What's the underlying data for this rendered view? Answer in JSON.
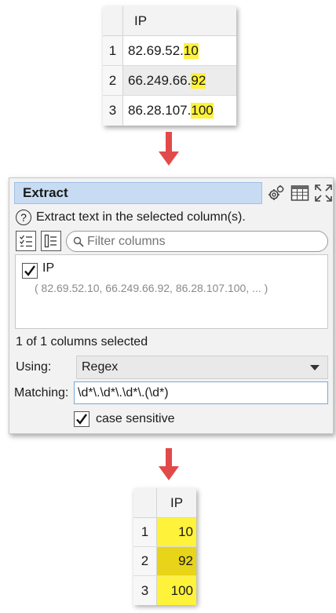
{
  "top_table": {
    "column": "IP",
    "rows": [
      {
        "num": "1",
        "prefix": "82.69.52.",
        "match": "10"
      },
      {
        "num": "2",
        "prefix": "66.249.66.",
        "match": "92"
      },
      {
        "num": "3",
        "prefix": "86.28.107.",
        "match": "100"
      }
    ]
  },
  "panel": {
    "title": "Extract",
    "description": "Extract text in the selected column(s).",
    "help_symbol": "?",
    "filter_placeholder": "Filter columns",
    "columns": [
      {
        "name": "IP",
        "checked": true,
        "sample": "( 82.69.52.10, 66.249.66.92, 86.28.107.100, ... )"
      }
    ],
    "selected_count": "1 of 1 columns selected",
    "using_label": "Using:",
    "using_value": "Regex",
    "matching_label": "Matching:",
    "matching_value": "\\d*\\.\\d*\\.\\d*\\.(\\d*)",
    "case_sensitive_label": "case sensitive",
    "case_sensitive_checked": true
  },
  "bottom_table": {
    "column": "IP",
    "rows": [
      {
        "num": "1",
        "value": "10"
      },
      {
        "num": "2",
        "value": "92"
      },
      {
        "num": "3",
        "value": "100"
      }
    ]
  },
  "icons": [
    "gear-icon",
    "table-icon",
    "expand-icon",
    "check-all-icon",
    "list-icon",
    "search-icon",
    "help-icon",
    "caret-down-icon",
    "checkmark-icon"
  ],
  "colors": {
    "highlight": "#fff23a",
    "highlight_selected": "#e8d418",
    "arrow": "#e24a4a",
    "title_bg": "#c7dcf3"
  }
}
